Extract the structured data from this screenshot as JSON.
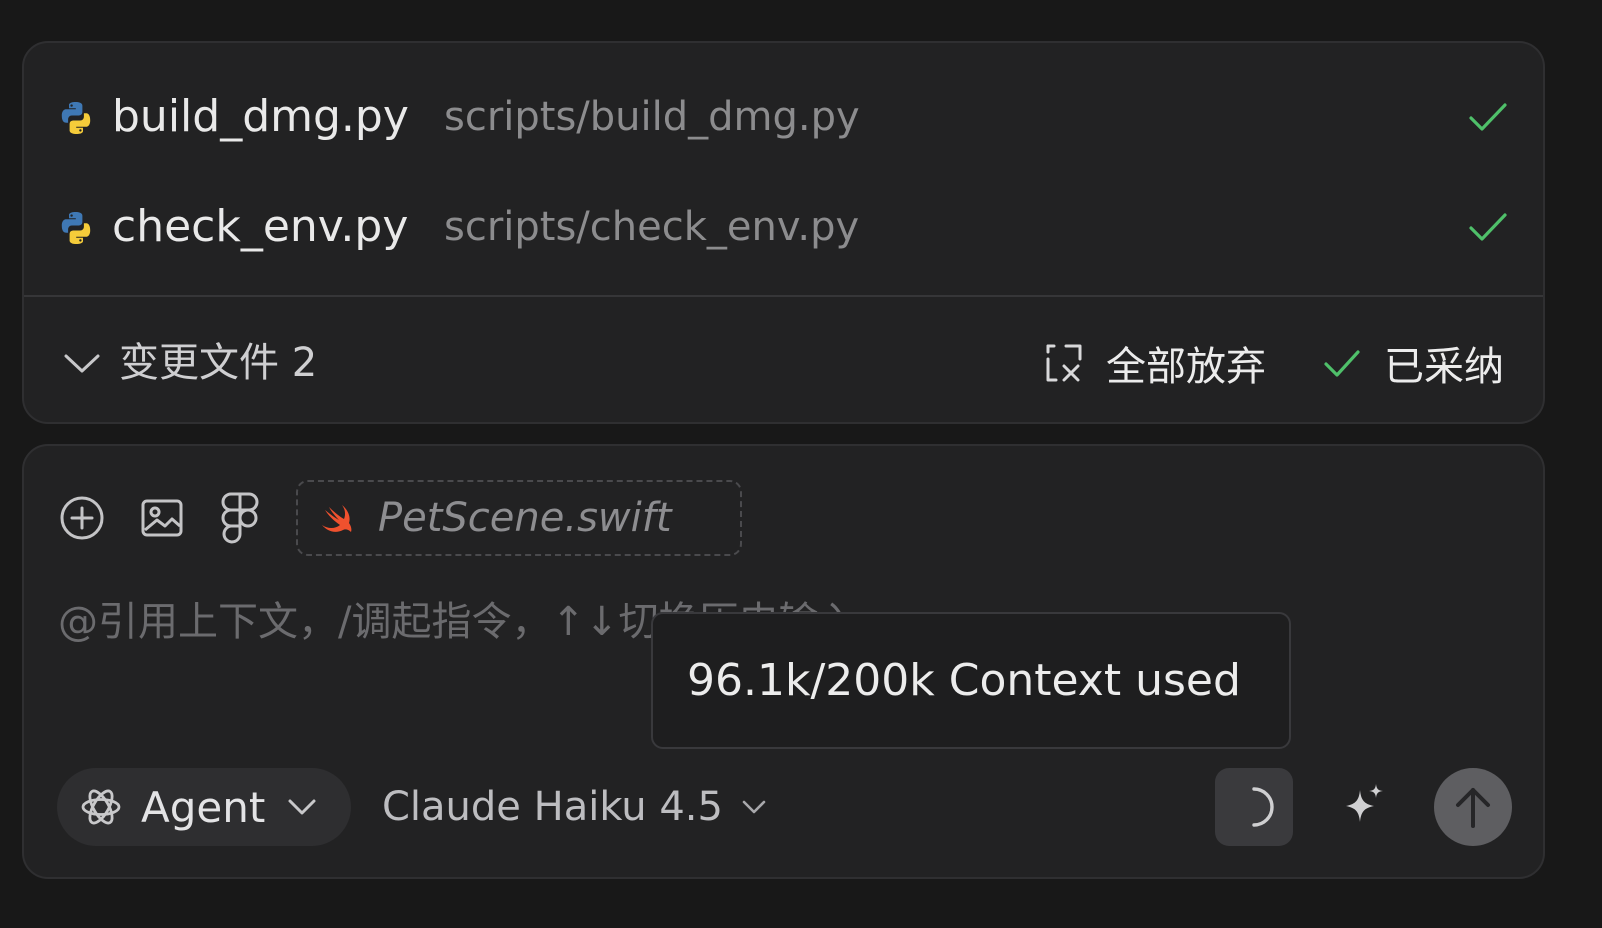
{
  "changes": {
    "files": [
      {
        "icon": "python-file-icon",
        "name": "build_dmg.py",
        "path": "scripts/build_dmg.py",
        "status": "accepted"
      },
      {
        "icon": "python-file-icon",
        "name": "check_env.py",
        "path": "scripts/check_env.py",
        "status": "accepted"
      }
    ],
    "summary_label": "变更文件 2",
    "discard_all_label": "全部放弃",
    "accepted_label": "已采纳"
  },
  "input": {
    "context_chip": {
      "icon": "swift-file-icon",
      "label": "PetScene.swift"
    },
    "placeholder": "@引用上下文，/调起指令，↑↓切换历史输入",
    "mode_label": "Agent",
    "model_label": "Claude Haiku 4.5"
  },
  "tooltip": {
    "text": "96.1k/200k Context used"
  },
  "colors": {
    "background": "#181818",
    "panel": "#222223",
    "accept_green": "#4fc06a",
    "swift_orange": "#f0512e",
    "python_blue": "#3f78b4",
    "python_yellow": "#f5cc3a"
  }
}
